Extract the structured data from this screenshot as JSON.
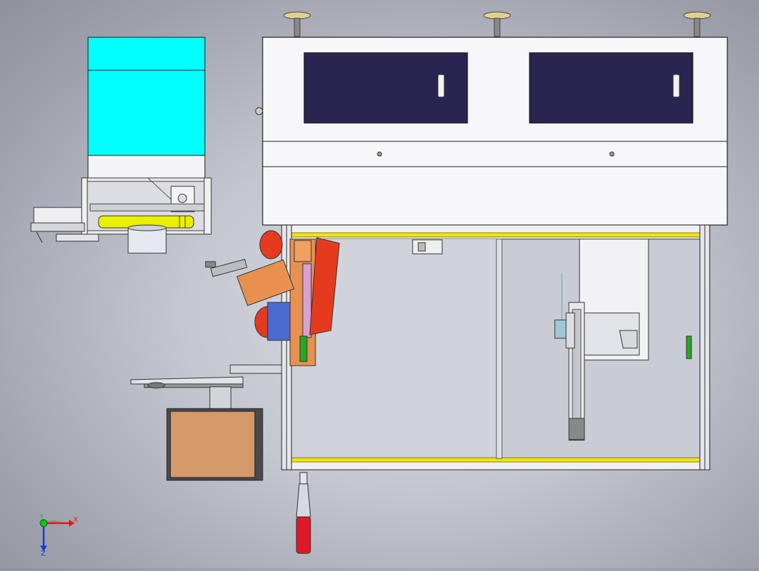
{
  "viewport": {
    "background_color": "#c4c7d0",
    "view": "top"
  },
  "colors": {
    "hopper": "#00ffff",
    "window_glass": "#2a2450",
    "robot_arm": "#e63a1f",
    "robot_base": "#4a6ad0",
    "roller": "#e8f000",
    "carton": "#d49a6a",
    "frame_stripe": "#f2e600",
    "handle": "#e01828",
    "indicator": "#22aa22",
    "axis_x": "#e01818",
    "axis_y": "#18c018",
    "axis_z": "#1838e0"
  },
  "triad": {
    "x_label": "X",
    "y_label": "Y",
    "z_label": "Z"
  }
}
